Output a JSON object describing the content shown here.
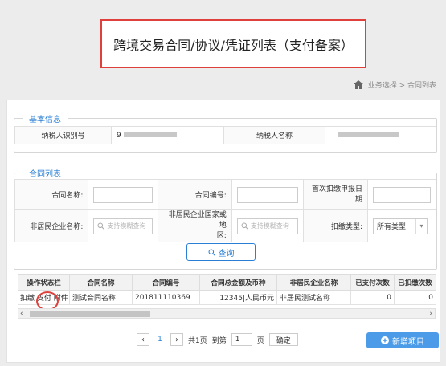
{
  "page": {
    "title": "跨境交易合同/协议/凭证列表（支付备案）"
  },
  "breadcrumb": {
    "items": "业务选择 > 合同列表"
  },
  "basic_info": {
    "legend": "基本信息",
    "taxpayer_id_label": "纳税人识别号",
    "taxpayer_id_value": "9",
    "taxpayer_name_label": "纳税人名称"
  },
  "filters": {
    "legend": "合同列表",
    "contract_name_label": "合同名称:",
    "contract_no_label": "合同编号:",
    "first_deduct_label_1": "首次扣缴申报日",
    "first_deduct_label_2": "期",
    "nonres_name_label": "非居民企业名称:",
    "nonres_name_placeholder": "支持模糊查询",
    "nonres_country_label_1": "非居民企业国家或地",
    "nonres_country_label_2": "区:",
    "nonres_country_placeholder": "支持模糊查询",
    "deduct_type_label": "扣缴类型:",
    "deduct_type_value": "所有类型",
    "query_label": "查询"
  },
  "grid": {
    "columns": [
      "操作状态栏",
      "合同名称",
      "合同编号",
      "合同总金额及币种",
      "非居民企业名称",
      "已支付次数",
      "已扣缴次数"
    ],
    "rows": [
      {
        "actions": [
          "扣缴",
          "支付",
          "附件"
        ],
        "contract_name": "测试合同名称",
        "contract_no": "201811110369",
        "amount": "12345|人民币元",
        "nonres_name": "非居民测试名称",
        "paid_count": "0",
        "deducted_count": "0"
      }
    ]
  },
  "pager": {
    "current_page": "1",
    "total_label": "共1页",
    "goto_label": "到第",
    "goto_value": "1",
    "page_unit": "页",
    "confirm_label": "确定"
  },
  "actions": {
    "add_label": "新增项目"
  },
  "colors": {
    "accent": "#2a7fd4",
    "highlight": "#e0403c",
    "add_button": "#4c9be8"
  }
}
